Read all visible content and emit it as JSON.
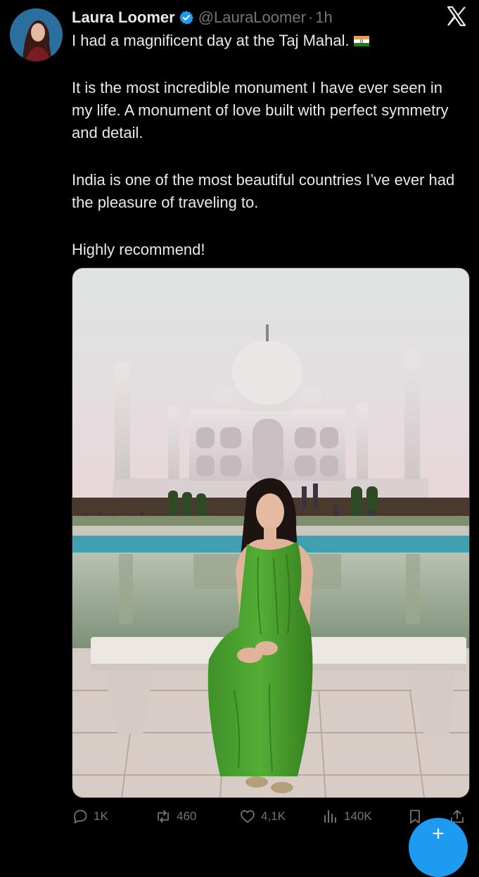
{
  "tweet": {
    "author_name": "Laura Loomer",
    "handle": "@LauraLoomer",
    "separator": "·",
    "time": "1h",
    "verified": true,
    "line1": "I had a magnificent day at the Taj Mahal.",
    "line1_flag": "india-flag-icon",
    "paragraph2": "It is the most incredible monument I have ever seen in my life. A monument of love built with perfect symmetry and detail.",
    "paragraph3": "India is one of the most beautiful countries I’ve ever had the pleasure of traveling to.",
    "paragraph4": "Highly recommend!"
  },
  "actions": {
    "replies": "1K",
    "reposts": "460",
    "likes": "4,1K",
    "views": "140K"
  },
  "icons": {
    "brand": "x-logo-icon",
    "reply": "reply-icon",
    "repost": "repost-icon",
    "like": "heart-icon",
    "views": "views-icon",
    "bookmark": "bookmark-icon",
    "share": "share-icon",
    "compose": "compose-button"
  },
  "colors": {
    "background": "#000000",
    "text": "#e7e9ea",
    "muted": "#71767b",
    "accent": "#1d9bf0"
  }
}
